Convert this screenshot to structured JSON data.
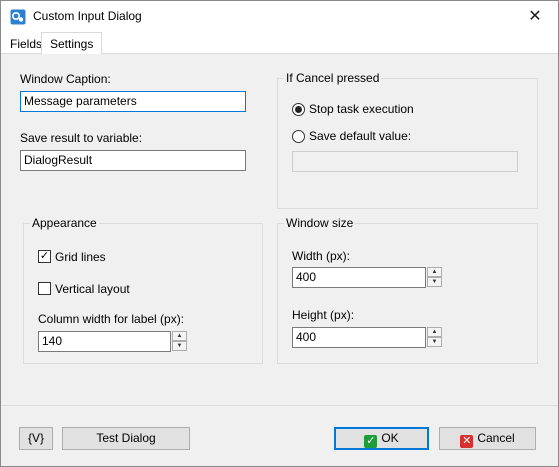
{
  "window": {
    "title": "Custom Input Dialog",
    "close_glyph": "✕"
  },
  "icons": {
    "app": "app-icon",
    "close": "close-icon",
    "check": "checkmark-icon",
    "ok": "ok-icon",
    "cancel": "cancel-icon",
    "spin_up": "spin-up-icon",
    "spin_down": "spin-down-icon"
  },
  "tabs": [
    {
      "label": "Fields",
      "selected": false
    },
    {
      "label": "Settings",
      "selected": true
    }
  ],
  "settings": {
    "window_caption_label": "Window Caption:",
    "window_caption_value": "Message parameters",
    "save_result_label": "Save result to variable:",
    "save_result_value": "DialogResult",
    "if_cancel": {
      "title": "If Cancel pressed",
      "stop_task_label": "Stop task execution",
      "stop_task_selected": true,
      "save_default_label": "Save default value:",
      "save_default_selected": false,
      "default_value": ""
    },
    "appearance": {
      "title": "Appearance",
      "grid_lines_label": "Grid lines",
      "grid_lines_checked": true,
      "vertical_layout_label": "Vertical layout",
      "vertical_layout_checked": false,
      "column_width_label": "Column width for label (px):",
      "column_width_value": "140"
    },
    "window_size": {
      "title": "Window size",
      "width_label": "Width (px):",
      "width_value": "400",
      "height_label": "Height (px):",
      "height_value": "400"
    }
  },
  "footer": {
    "variables_label": "{V}",
    "test_dialog_label": "Test Dialog",
    "ok_label": "OK",
    "cancel_label": "Cancel"
  },
  "colors": {
    "accent": "#0078d7",
    "ok_green": "#1f9d3a",
    "cancel_red": "#d8302f"
  }
}
